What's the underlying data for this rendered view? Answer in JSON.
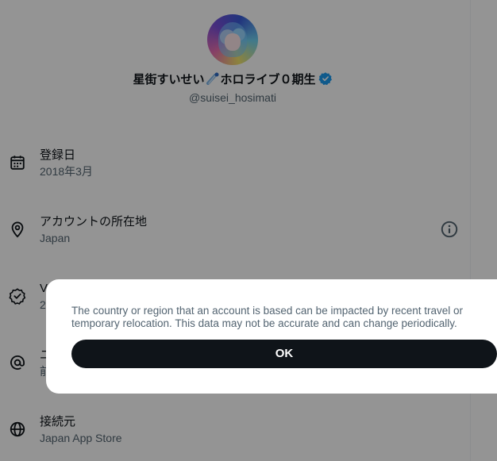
{
  "profile": {
    "name_part1": "星街すいせい",
    "name_part2": "ホロライブ０期生",
    "handle": "@suisei_hosimati"
  },
  "about_rows": [
    {
      "icon": "calendar-icon",
      "title": "登録日",
      "value": "2018年3月"
    },
    {
      "icon": "location-pin-icon",
      "title": "アカウントの所在地",
      "value": "Japan"
    },
    {
      "icon": "verified-badge-icon",
      "title": "V",
      "value": "2"
    },
    {
      "icon": "at-sign-icon",
      "title": "ユ",
      "value": "前"
    },
    {
      "icon": "globe-icon",
      "title": "接続元",
      "value": "Japan App Store"
    }
  ],
  "dialog": {
    "message": "The country or region that an account is based can be impacted by recent travel or temporary relocation. This data may not be accurate and can change periodically.",
    "ok_label": "OK"
  },
  "colors": {
    "verified_blue": "#1d9bf0",
    "text_primary": "#0f1419",
    "text_secondary": "#536471",
    "button_dark": "#0f1419"
  }
}
